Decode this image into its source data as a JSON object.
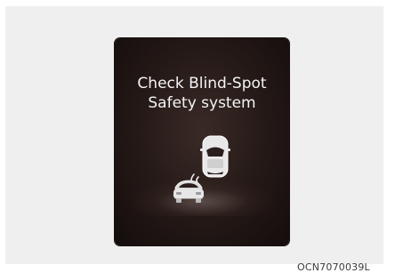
{
  "display": {
    "message_line1": "Check Blind-Spot",
    "message_line2": "Safety system"
  },
  "figure_code": "OCN7070039L",
  "colors": {
    "screen_background": "#231816",
    "text": "#f4f4f4",
    "panel_background": "#efefef"
  },
  "icons": [
    "rear-vehicle-icon",
    "sensor-wave-icon",
    "own-vehicle-icon"
  ]
}
